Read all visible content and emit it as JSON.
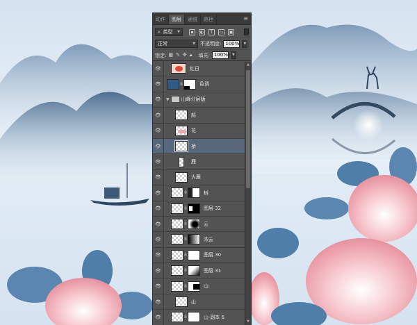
{
  "panel": {
    "tabs": [
      "动作",
      "图层",
      "通道",
      "路径"
    ],
    "active_tab": 1,
    "kind_filter": "类型",
    "blend_mode": "正常",
    "opacity_label": "不透明度:",
    "opacity_value": "100%",
    "lock_label": "锁定:",
    "fill_label": "填充:",
    "fill_value": "100%"
  },
  "layers": [
    {
      "name": "红日",
      "type": "pixel",
      "selected": false
    },
    {
      "name": "色调",
      "type": "adjust",
      "selected": false
    },
    {
      "name": "山峰分层版",
      "type": "folder",
      "selected": false
    },
    {
      "name": "船",
      "type": "pixel",
      "selected": false
    },
    {
      "name": "花",
      "type": "pixel",
      "selected": false
    },
    {
      "name": "桥",
      "type": "pixel",
      "selected": true
    },
    {
      "name": "鹿",
      "type": "pixel",
      "selected": false
    },
    {
      "name": "大雁",
      "type": "pixel",
      "selected": false
    },
    {
      "name": "树",
      "type": "masked",
      "selected": false
    },
    {
      "name": "图层 32",
      "type": "masked",
      "selected": false
    },
    {
      "name": "云",
      "type": "masked",
      "selected": false
    },
    {
      "name": "浓云",
      "type": "masked",
      "selected": false
    },
    {
      "name": "图层 30",
      "type": "masked",
      "selected": false
    },
    {
      "name": "图层 31",
      "type": "masked",
      "selected": false
    },
    {
      "name": "山",
      "type": "masked",
      "selected": false
    },
    {
      "name": "山",
      "type": "pixel",
      "selected": false
    },
    {
      "name": "山 副本 6",
      "type": "masked",
      "selected": false
    }
  ],
  "colors": {
    "panel_bg": "#535353",
    "selected_row": "#59677a",
    "sky": "#dbe7f2",
    "mountain": "#5f7f9e",
    "peony": "#f3b6bf",
    "leaf": "#5a86b0"
  }
}
